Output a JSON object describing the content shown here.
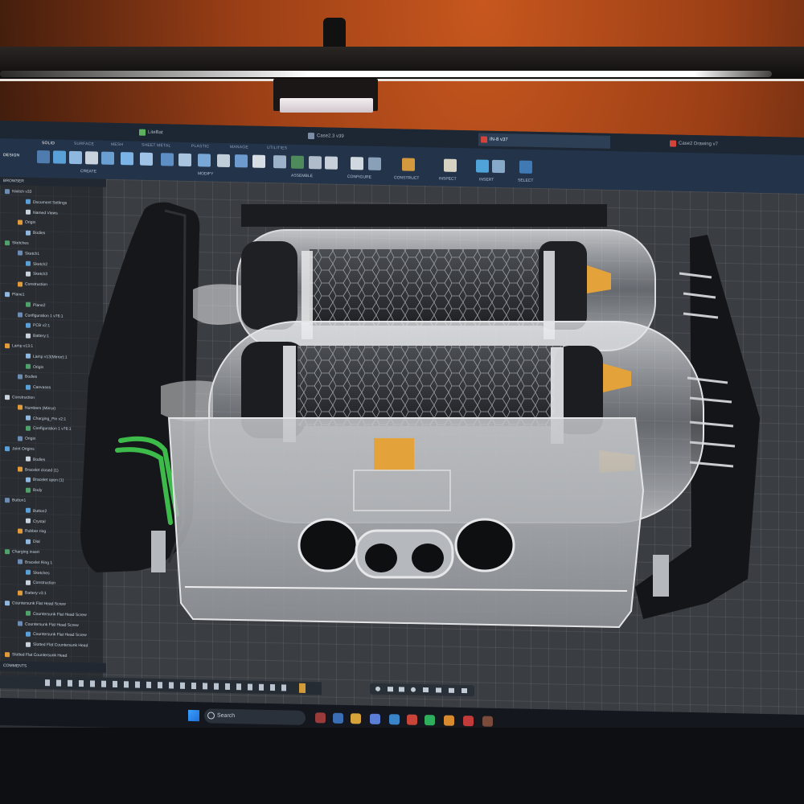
{
  "tabs": [
    {
      "label": "LiteBat"
    },
    {
      "label": "Case2.3 v39"
    },
    {
      "label": "IN-8 v37",
      "active": true
    },
    {
      "label": "Case2 Drawing v7"
    }
  ],
  "ribbon": {
    "mode": "DESIGN",
    "tabs": [
      "SOLID",
      "SURFACE",
      "MESH",
      "SHEET METAL",
      "PLASTIC",
      "MANAGE",
      "UTILITIES"
    ],
    "groups": [
      "CREATE",
      "MODIFY",
      "ASSEMBLE",
      "CONFIGURE",
      "CONSTRUCT",
      "INSPECT",
      "INSERT",
      "SELECT"
    ]
  },
  "browser": {
    "title": "BROWSER",
    "rows": [
      "Nixitch v33",
      "Document Settings",
      "Named Views",
      "Origin",
      "Bodies",
      "Sketches",
      "Sketch1",
      "Sketch2",
      "Sketch3",
      "Construction",
      "Plane1",
      "Plane2",
      "Configuration 1 v76:1",
      "PCB v2:1",
      "Battery:1",
      "Lamp v13:1",
      "Lamp v13(Mirror):1",
      "Origin",
      "Bodies",
      "Canvases",
      "Construction",
      "Numbers (Mirror)",
      "Charging_Pin v2:1",
      "Configuration 1 v76:1",
      "Origin",
      "Joint Origins",
      "Bodies",
      "Bracelet closed (1)",
      "Bracelet open (1)",
      "Body",
      "Button1",
      "Button2",
      "Crystal",
      "Rubber ring",
      "Dial",
      "Charging insert",
      "Bracelet Ring 1",
      "Sketches",
      "Construction",
      "Battery v3:1",
      "Countersunk Flat Head Screw",
      "Countersunk Flat Head Screw",
      "Countersunk Flat Head Screw",
      "Countersunk Flat Head Screw",
      "Slotted Flat Countersunk Head",
      "Slotted Flat Countersunk Head"
    ]
  },
  "comments_label": "COMMENTS",
  "taskbar": {
    "search_placeholder": "Search"
  }
}
